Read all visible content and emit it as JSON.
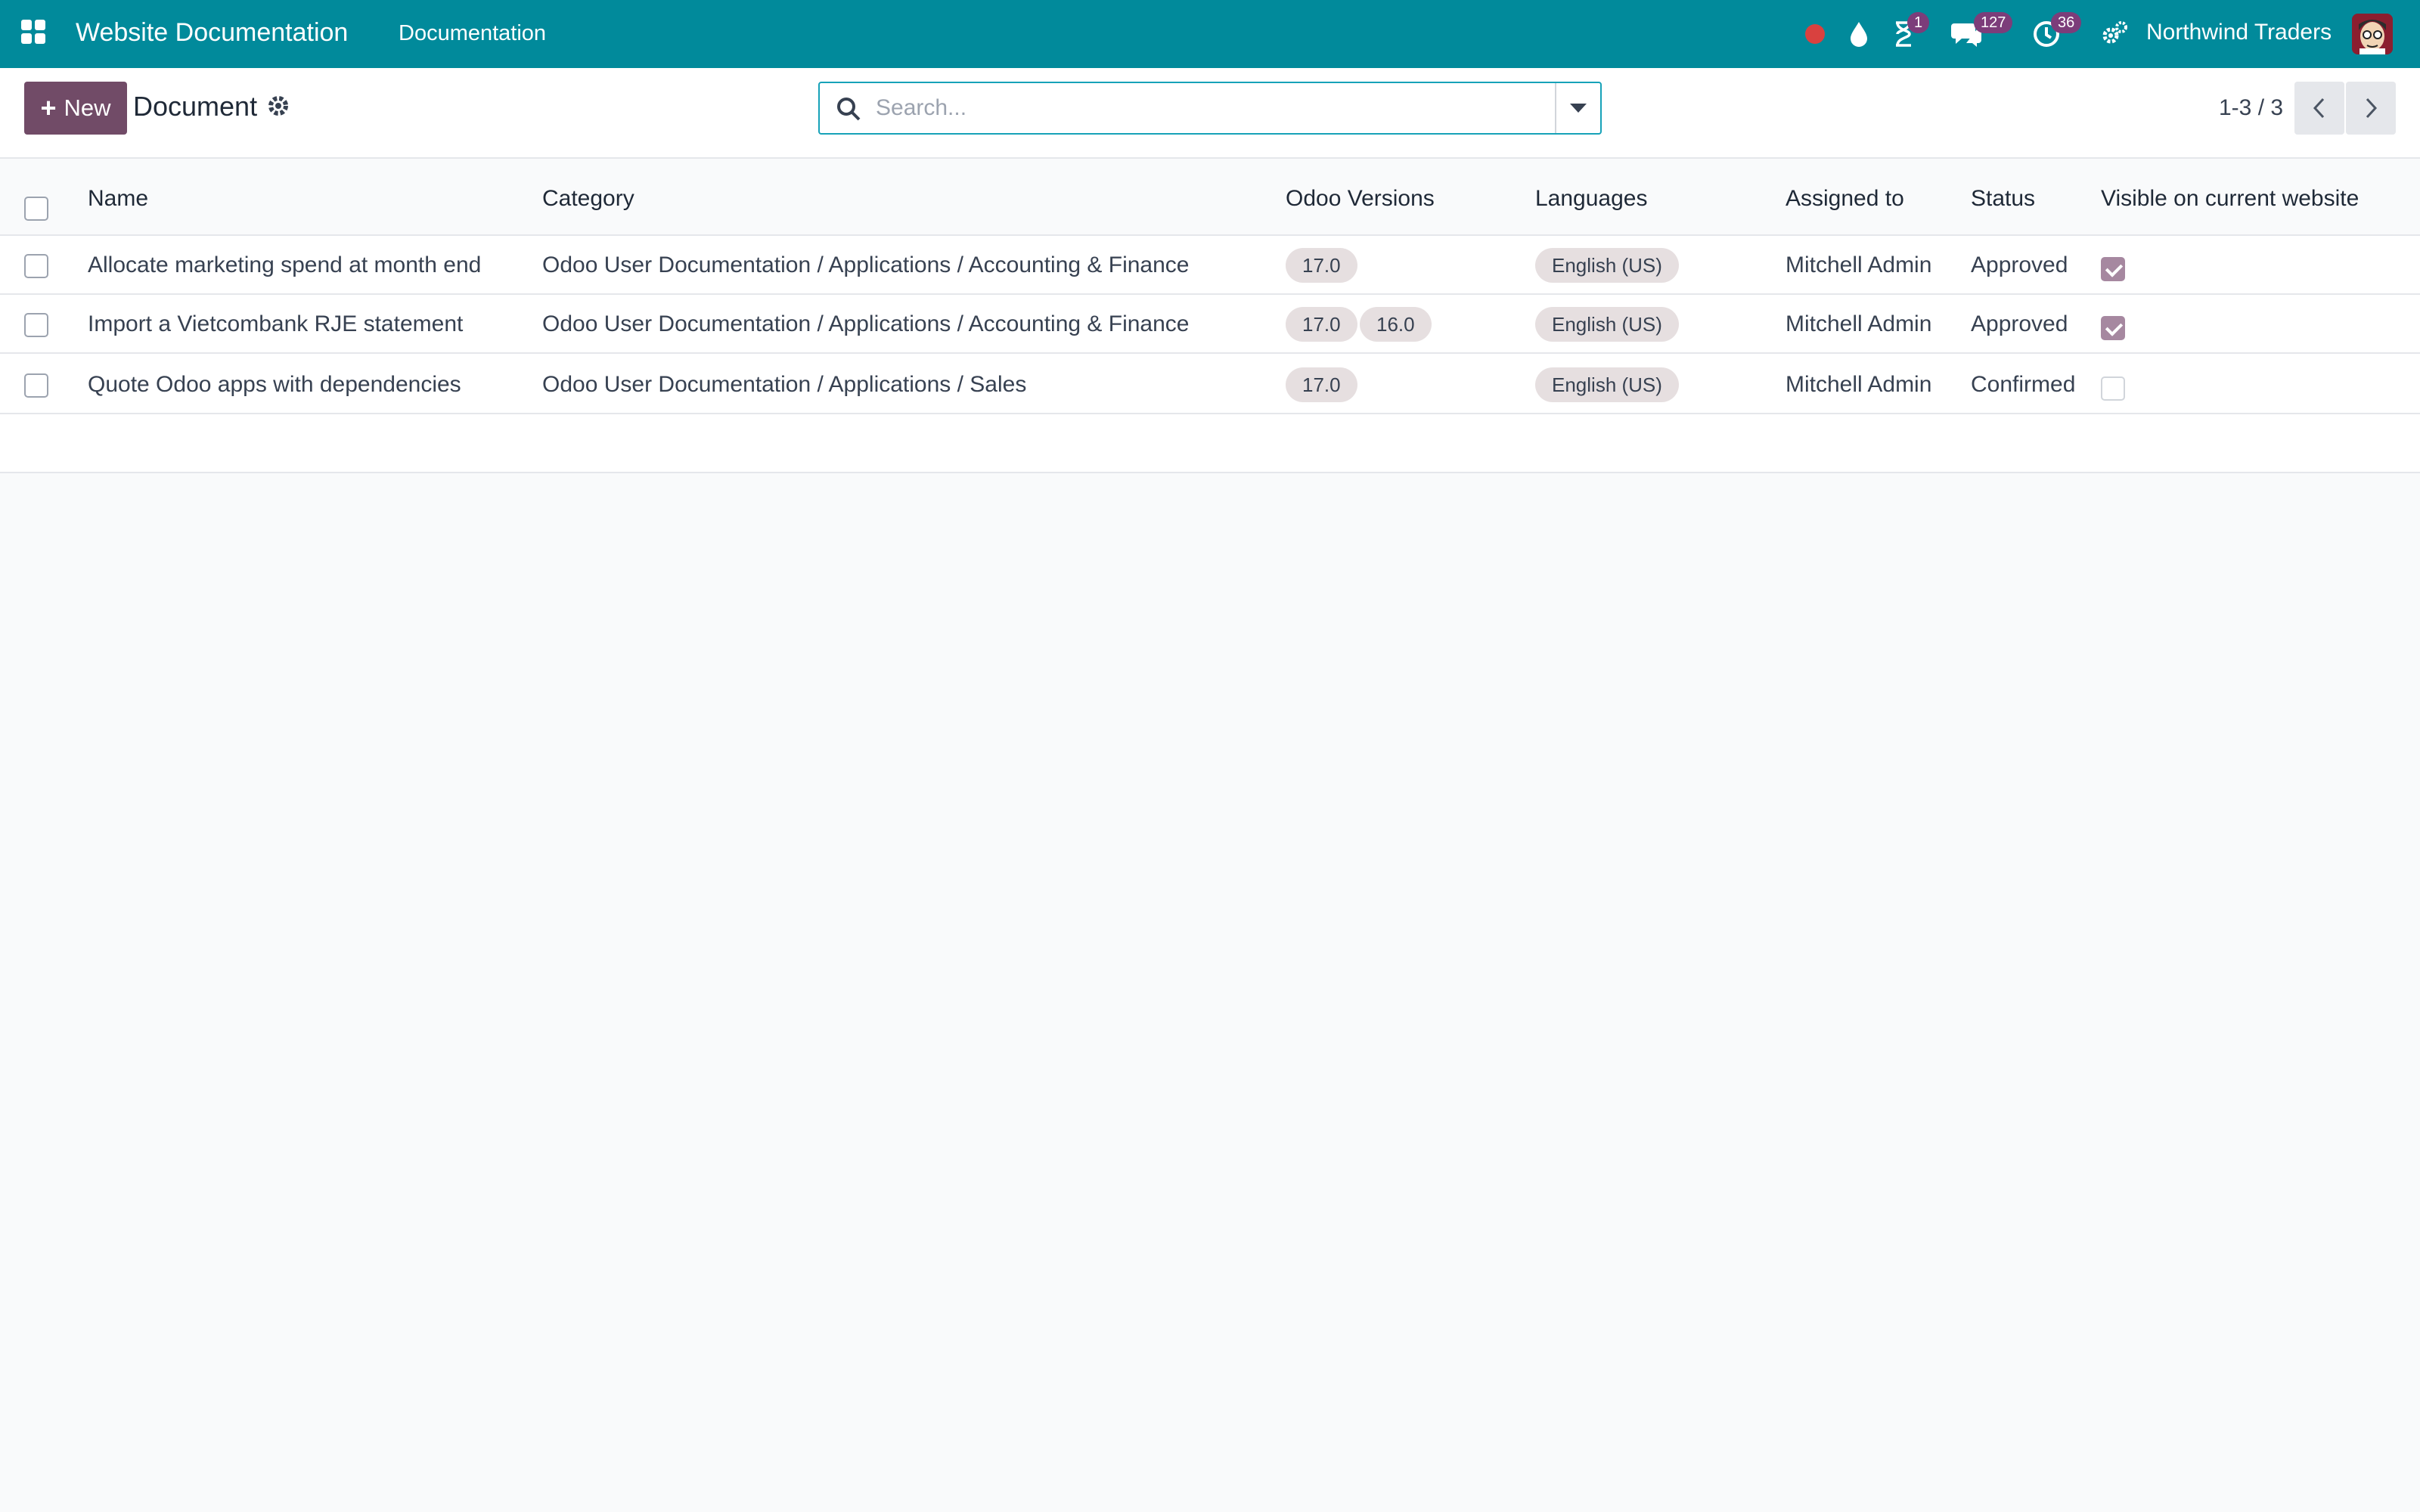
{
  "navbar": {
    "app_title": "Website Documentation",
    "menu_item": "Documentation",
    "activity_badge": "1",
    "messages_badge": "127",
    "clock_badge": "36",
    "company": "Northwind Traders",
    "bg_color": "#018a9b",
    "record_dot_color": "#d9413f"
  },
  "control": {
    "new_label": "New",
    "title": "Document",
    "search_placeholder": "Search...",
    "pager": "1-3 / 3",
    "accent": "#714b67"
  },
  "table": {
    "columns": {
      "name": "Name",
      "category": "Category",
      "versions": "Odoo Versions",
      "languages": "Languages",
      "assigned": "Assigned to",
      "status": "Status",
      "visible": "Visible on current website"
    },
    "rows": [
      {
        "name": "Allocate marketing spend at month end",
        "category": "Odoo User Documentation / Applications / Accounting & Finance",
        "versions": [
          "17.0"
        ],
        "language": "English (US)",
        "assigned": "Mitchell Admin",
        "status": "Approved",
        "visible": true
      },
      {
        "name": "Import a Vietcombank RJE statement",
        "category": "Odoo User Documentation / Applications / Accounting & Finance",
        "versions": [
          "17.0",
          "16.0"
        ],
        "language": "English (US)",
        "assigned": "Mitchell Admin",
        "status": "Approved",
        "visible": true
      },
      {
        "name": "Quote Odoo apps with dependencies",
        "category": "Odoo User Documentation / Applications / Sales",
        "versions": [
          "17.0"
        ],
        "language": "English (US)",
        "assigned": "Mitchell Admin",
        "status": "Confirmed",
        "visible": false
      }
    ]
  }
}
